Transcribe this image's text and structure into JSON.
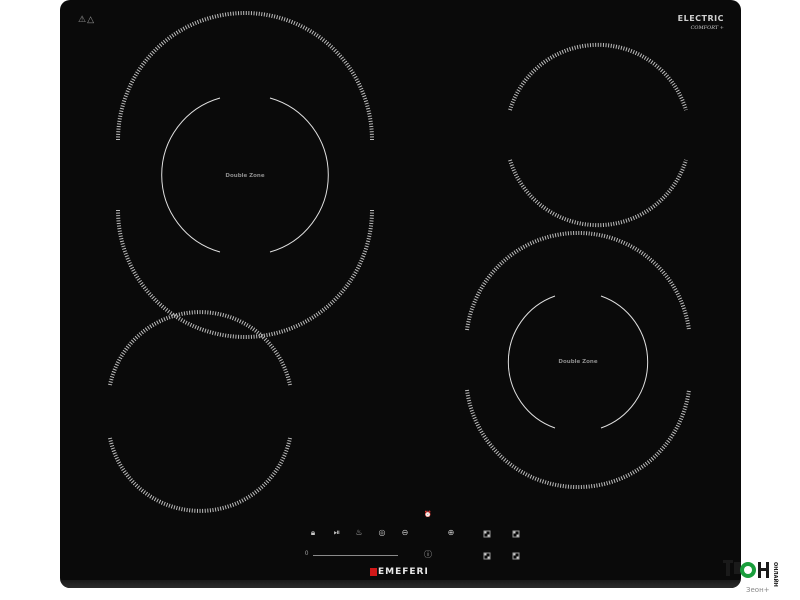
{
  "product": {
    "type_label": "ELECTRIC",
    "series_label": "COMFORT +",
    "brand": "EMEFERI"
  },
  "zones": [
    {
      "name": "front-left-double",
      "label": "Double Zone"
    },
    {
      "name": "rear-left",
      "label": ""
    },
    {
      "name": "back-right",
      "label": ""
    },
    {
      "name": "front-right-double",
      "label": "Double Zone"
    }
  ],
  "warning_icons": "⚠△",
  "controls": {
    "lock_icon": "lock-icon",
    "pause_icon": "pause-icon",
    "keep_warm_icon": "keep-warm-icon",
    "timer_icon": "timer-icon",
    "minus_icon": "minus-icon",
    "plus_icon": "plus-icon",
    "power_icon": "power-icon",
    "slider_min": "0"
  },
  "watermark": {
    "brand": "ОНЛАЙН",
    "caption": "Зеон+"
  },
  "colors": {
    "glass": "#0a0a0a",
    "ring": "#bdbdbd",
    "logo_red": "#d01818",
    "watermark_green": "#1a9e3c"
  }
}
